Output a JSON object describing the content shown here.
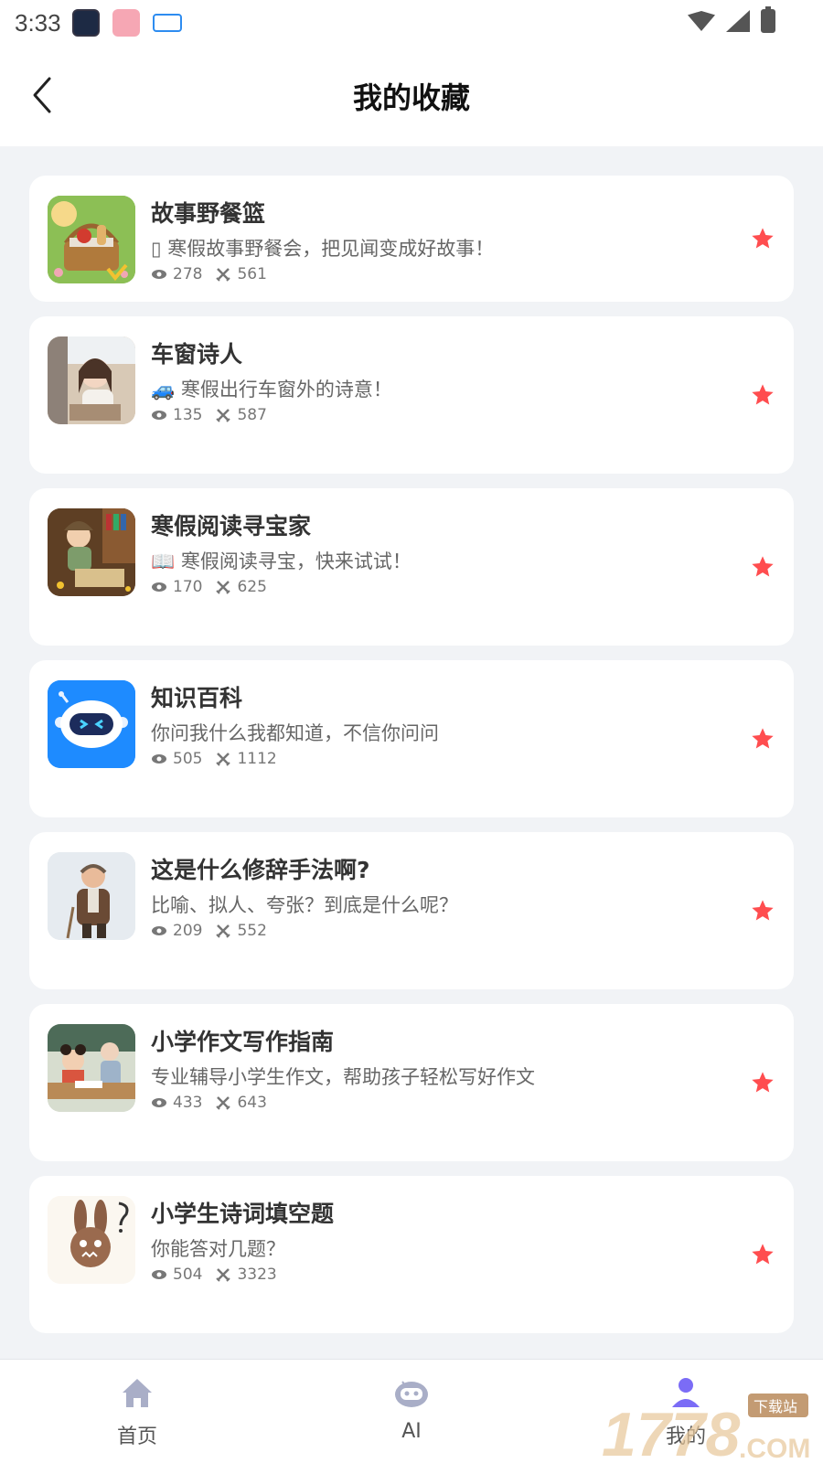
{
  "status_bar": {
    "time": "3:33",
    "icons": [
      "calendar-widget-icon",
      "rice-app-icon",
      "car-app-icon",
      "wifi-icon",
      "signal-icon",
      "battery-charging-icon"
    ]
  },
  "header": {
    "title": "我的收藏",
    "back_icon": "chevron-left-icon"
  },
  "items": [
    {
      "title": "故事野餐篮",
      "desc": "▯ 寒假故事野餐会，把见闻变成好故事！",
      "views": "278",
      "uses": "561",
      "thumb": "picnic-basket-image",
      "favorited": true
    },
    {
      "title": "车窗诗人",
      "desc": "🚙 寒假出行车窗外的诗意！",
      "views": "135",
      "uses": "587",
      "thumb": "girl-in-car-image",
      "favorited": true
    },
    {
      "title": "寒假阅读寻宝家",
      "desc": "📖 寒假阅读寻宝，快来试试！",
      "views": "170",
      "uses": "625",
      "thumb": "boy-reading-treasure-image",
      "favorited": true
    },
    {
      "title": "知识百科",
      "desc": "你问我什么我都知道，不信你问问",
      "views": "505",
      "uses": "1112",
      "thumb": "robot-head-image",
      "favorited": true
    },
    {
      "title": "这是什么修辞手法啊?",
      "desc": "比喻、拟人、夸张？到底是什么呢？",
      "views": "209",
      "uses": "552",
      "thumb": "old-man-image",
      "favorited": true
    },
    {
      "title": "小学作文写作指南",
      "desc": "专业辅导小学生作文，帮助孩子轻松写好作文",
      "views": "433",
      "uses": "643",
      "thumb": "kids-writing-classroom-image",
      "favorited": true
    },
    {
      "title": "小学生诗词填空题",
      "desc": "你能答对几题？",
      "views": "504",
      "uses": "3323",
      "thumb": "rabbit-question-image",
      "favorited": true
    }
  ],
  "bottom_nav": [
    {
      "label": "首页",
      "icon": "home-icon",
      "active": false
    },
    {
      "label": "AI",
      "icon": "robot-icon",
      "active": false
    },
    {
      "label": "我的",
      "icon": "profile-icon",
      "active": true
    }
  ],
  "colors": {
    "accent_star": "#ff4d4f",
    "nav_icon_inactive": "#a9aec7",
    "nav_icon_active": "#7b6cf6"
  }
}
